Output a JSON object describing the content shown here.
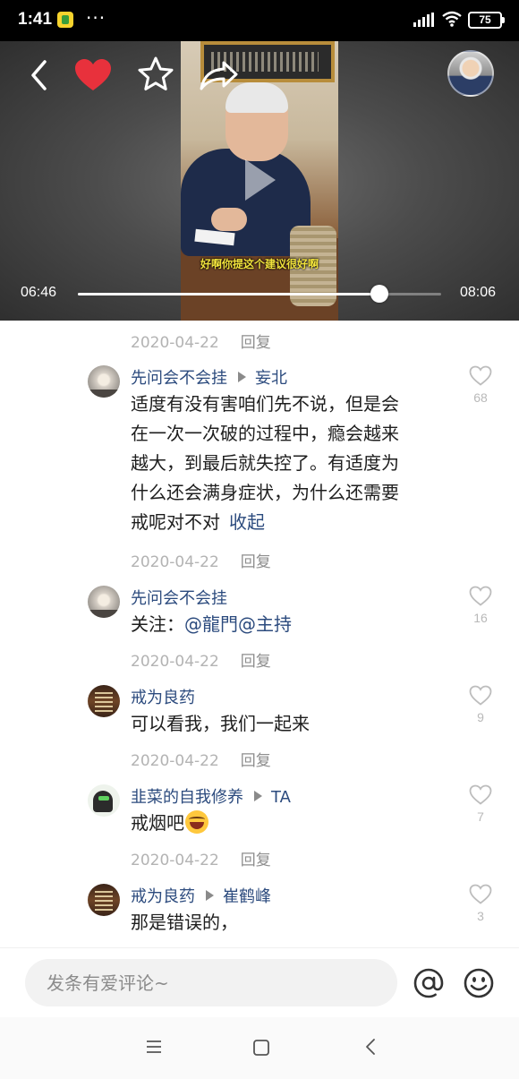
{
  "status_bar": {
    "time": "1:41",
    "more": "···",
    "battery": "75"
  },
  "video": {
    "subtitle": "好啊你提这个建议很好啊",
    "current_time": "06:46",
    "total_time": "08:06",
    "progress": 0.83,
    "liked": true,
    "like_color": "#e8313c",
    "icons": [
      "back-icon",
      "heart-icon",
      "star-icon",
      "share-icon",
      "play-icon"
    ]
  },
  "comments": {
    "reply_label": "回复",
    "collapse_label": "收起",
    "top_meta_date": "2020-04-22",
    "items": [
      {
        "author": "先问会不会挂",
        "reply_to": "妄北",
        "lines": [
          "适度有没有害咱们先不说，但是会",
          "在一次一次破的过程中，瘾会越来",
          "越大，到最后就失控了。有适度为",
          "什么还会满身症状，为什么还需要",
          "戒呢对不对"
        ],
        "likes": "68",
        "date": "2020-04-22"
      },
      {
        "author": "先问会不会挂",
        "text_prefix": "关注：",
        "mentions": "@龍門@主持",
        "likes": "16",
        "date": "2020-04-22"
      },
      {
        "author": "戒为良药",
        "text": "可以看我，我们一起来",
        "likes": "9",
        "date": "2020-04-22"
      },
      {
        "author": "韭菜的自我修养",
        "reply_to": "TA",
        "text": "戒烟吧",
        "emoji": "laughing-tears-emoji",
        "likes": "7",
        "date": "2020-04-22"
      },
      {
        "author": "戒为良药",
        "reply_to": "崔鹤峰",
        "text": "那是错误的，",
        "likes": "3"
      }
    ]
  },
  "input_bar": {
    "placeholder": "发条有爱评论~"
  },
  "colors": {
    "name_blue": "#2c4b7e",
    "meta_gray": "#b3b3b3"
  }
}
